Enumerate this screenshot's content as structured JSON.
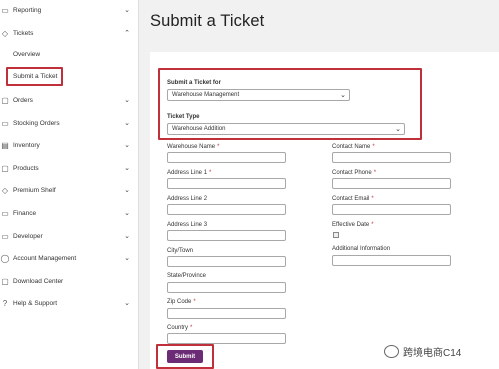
{
  "sidebar": {
    "items": [
      {
        "label": "Reporting",
        "icon": "reporting-icon",
        "chev": "⌄"
      },
      {
        "label": "Tickets",
        "icon": "tag-icon",
        "chev": "⌃"
      },
      {
        "label": "Orders",
        "icon": "orders-icon",
        "chev": "⌄"
      },
      {
        "label": "Stocking Orders",
        "icon": "truck-icon",
        "chev": "⌄"
      },
      {
        "label": "Inventory",
        "icon": "inventory-icon",
        "chev": "⌄"
      },
      {
        "label": "Products",
        "icon": "products-icon",
        "chev": "⌄"
      },
      {
        "label": "Premium Shelf",
        "icon": "shelf-icon",
        "chev": "⌄"
      },
      {
        "label": "Finance",
        "icon": "finance-icon",
        "chev": "⌄"
      },
      {
        "label": "Developer",
        "icon": "developer-icon",
        "chev": "⌄"
      },
      {
        "label": "Account Management",
        "icon": "user-icon",
        "chev": "⌄"
      },
      {
        "label": "Download Center",
        "icon": "download-icon",
        "chev": ""
      },
      {
        "label": "Help & Support",
        "icon": "help-icon",
        "chev": "⌄"
      }
    ],
    "sub_items": {
      "overview": "Overview",
      "submit_ticket": "Submit a Ticket"
    }
  },
  "main": {
    "title": "Submit a Ticket",
    "ticket_for": {
      "label": "Submit a Ticket for",
      "value": "Warehouse Management"
    },
    "ticket_type": {
      "label": "Ticket Type",
      "value": "Warehouse Addition"
    },
    "left_fields": [
      {
        "label": "Warehouse Name",
        "required": "*"
      },
      {
        "label": "Address Line 1",
        "required": "*"
      },
      {
        "label": "Address Line 2",
        "required": ""
      },
      {
        "label": "Address Line 3",
        "required": ""
      },
      {
        "label": "City/Town",
        "required": ""
      },
      {
        "label": "State/Province",
        "required": ""
      },
      {
        "label": "Zip Code",
        "required": "*"
      },
      {
        "label": "Country",
        "required": "*"
      }
    ],
    "right_fields": [
      {
        "label": "Contact Name",
        "required": "*"
      },
      {
        "label": "Contact Phone",
        "required": "*"
      },
      {
        "label": "Contact Email",
        "required": "*"
      },
      {
        "label": "Effective Date",
        "required": "*"
      },
      {
        "label": "Additional Information",
        "required": ""
      }
    ],
    "submit_label": "Submit"
  },
  "watermark": "跨境电商C14",
  "colors": {
    "accent": "#6b2c75",
    "highlight": "#c0303a",
    "required": "#c0303a"
  }
}
